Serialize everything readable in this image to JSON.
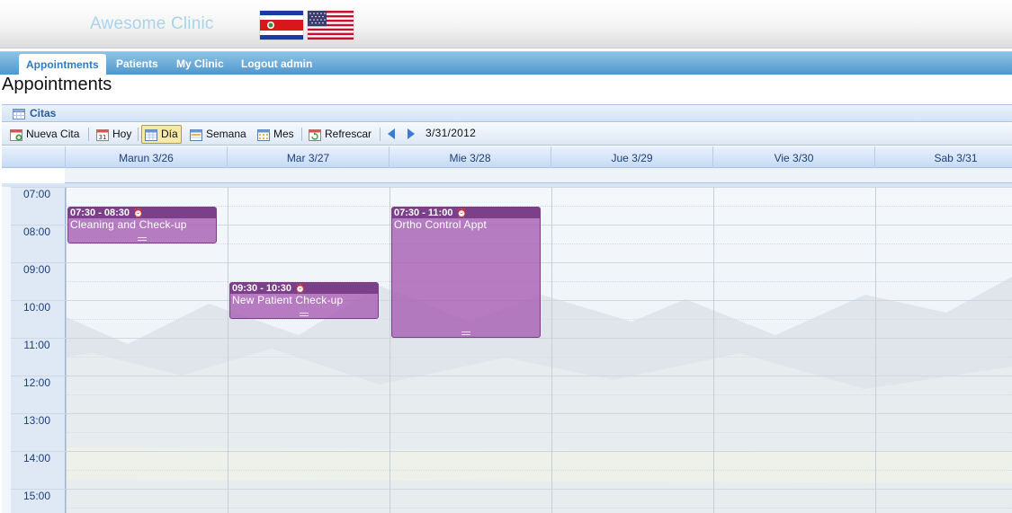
{
  "header": {
    "clinic_name": "Awesome Clinic",
    "flags": [
      "costa-rica-flag",
      "usa-flag"
    ]
  },
  "nav": {
    "items": [
      {
        "label": "Appointments",
        "active": true
      },
      {
        "label": "Patients",
        "active": false
      },
      {
        "label": "My Clinic",
        "active": false
      },
      {
        "label": "Logout admin",
        "active": false
      }
    ]
  },
  "page": {
    "title": "Appointments"
  },
  "panel": {
    "title": "Citas"
  },
  "toolbar": {
    "new_appt": "Nueva Cita",
    "today": "Hoy",
    "day": "Día",
    "week": "Semana",
    "month": "Mes",
    "refresh": "Refrescar",
    "current_date": "3/31/2012",
    "selected_view": "Día"
  },
  "calendar": {
    "days": [
      "Marun 3/26",
      "Mar 3/27",
      "Mie 3/28",
      "Jue 3/29",
      "Vie 3/30",
      "Sab 3/31"
    ],
    "hours": [
      "07:00",
      "08:00",
      "09:00",
      "10:00",
      "11:00",
      "12:00",
      "13:00",
      "14:00",
      "15:00"
    ],
    "appointments": [
      {
        "day": 0,
        "start": "07:30",
        "end": "08:30",
        "time_label": "07:30 - 08:30",
        "title": "Cleaning and Check-up"
      },
      {
        "day": 1,
        "start": "09:30",
        "end": "10:30",
        "time_label": "09:30 - 10:30",
        "title": "New Patient Check-up"
      },
      {
        "day": 2,
        "start": "07:30",
        "end": "11:00",
        "time_label": "07:30 - 11:00",
        "title": "Ortho Control Appt"
      }
    ]
  },
  "colors": {
    "nav": "#4f97cc",
    "appointment": "#a860b4",
    "appointment_header": "#7c3f8a"
  }
}
